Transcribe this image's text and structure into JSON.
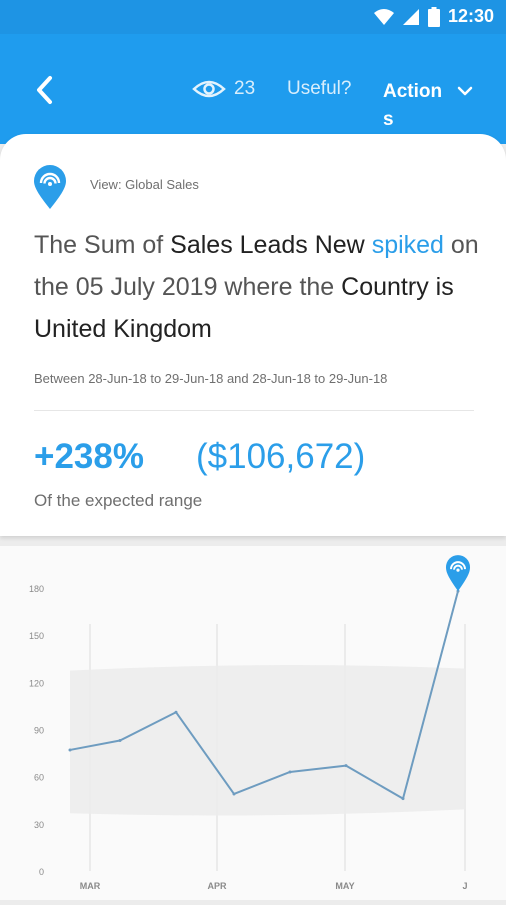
{
  "status_bar": {
    "time": "12:30",
    "icons": [
      "wifi-icon",
      "signal-icon",
      "battery-icon"
    ]
  },
  "app_bar": {
    "back_icon": "chevron-left-icon",
    "view_count": "23",
    "useful_label": "Useful?",
    "actions_label": "Actions",
    "colors": {
      "background": "#1f9cee",
      "status": "#1e94e4"
    }
  },
  "card": {
    "view_label": "View: Global Sales",
    "headline": {
      "part1": "The Sum of ",
      "measure": "Sales Leads New",
      "part2": " ",
      "trend": "spiked",
      "part3": " on the 05 July 2019 where the ",
      "dimension": "Country  is United Kingdom"
    },
    "date_range": "Between 28-Jun-18 to 29-Jun-18 and 28-Jun-18 to 29-Jun-18",
    "percent": "+238%",
    "amount": "($106,672)",
    "range_label": "Of the expected range",
    "accent_color": "#2b9ee9"
  },
  "chart_data": {
    "type": "line",
    "x_labels": [
      "MAR",
      "APR",
      "MAY",
      "J"
    ],
    "y_ticks": [
      0,
      30,
      60,
      90,
      120,
      150,
      180
    ],
    "ylim": [
      0,
      180
    ],
    "series": [
      {
        "values": [
          77,
          83,
          101,
          49,
          63,
          67,
          46,
          178
        ]
      }
    ],
    "expected_band": {
      "upper": 130,
      "lower": 38
    },
    "grid": true,
    "line_color": "#6e9cc0",
    "band_color": "#ececec",
    "marker_icon": "pin-icon"
  }
}
